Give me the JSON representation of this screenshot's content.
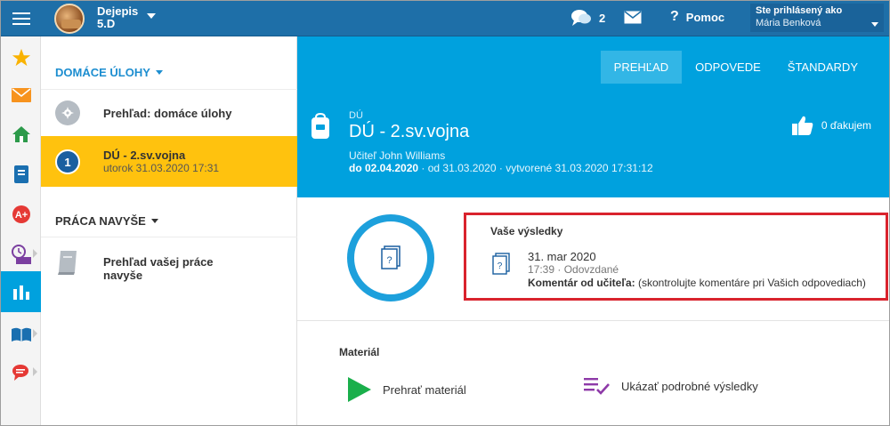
{
  "topbar": {
    "subject_name": "Dejepis",
    "subject_class": "5.D",
    "messages_count": "2",
    "help_label": "Pomoc",
    "user_label": "Ste prihlásený ako",
    "user_name": "Mária Benková"
  },
  "rail": {
    "items": [
      "star-icon",
      "mail-icon",
      "home-icon",
      "notebook-icon",
      "grade-icon",
      "schedule-icon",
      "results-icon",
      "book-icon",
      "chat-icon"
    ],
    "active_index": 6
  },
  "nav": {
    "homework_section": "DOMÁCE ÚLOHY",
    "overview_item": "Prehľad: domáce úlohy",
    "selected_number": "1",
    "selected_title": "DÚ - 2.sv.vojna",
    "selected_date": "utorok 31.03.2020 17:31",
    "extra_section": "PRÁCA NAVYŠE",
    "extra_item": "Prehľad vašej práce navyše"
  },
  "tabs": [
    "PREHĽAD",
    "ODPOVEDE",
    "ŠTANDARDY"
  ],
  "tabs_active": "PREHĽAD",
  "homework": {
    "kicker": "DÚ",
    "title": "DÚ - 2.sv.vojna",
    "teacher": "Učiteľ John Williams",
    "due": "do 02.04.2020",
    "from": "od 31.03.2020",
    "created": "vytvorené 31.03.2020 17:31:12",
    "thanks": "0 ďakujem"
  },
  "results": {
    "heading": "Vaše výsledky",
    "date": "31. mar 2020",
    "time": "17:39",
    "status": "Odovzdané",
    "comment_label": "Komentár od učiteľa:",
    "comment_text": "(skontrolujte komentáre pri Vašich odpovediach)"
  },
  "material": {
    "title": "Materiál",
    "play": "Prehrať materiál",
    "details": "Ukázať podrobné výsledky"
  },
  "colors": {
    "topbar": "#1e6fa8",
    "accent": "#00a1de",
    "selected": "#ffc20e",
    "highlight_border": "#d9232d",
    "play_green": "#1aaf4b",
    "details_purple": "#8e3aa8"
  }
}
